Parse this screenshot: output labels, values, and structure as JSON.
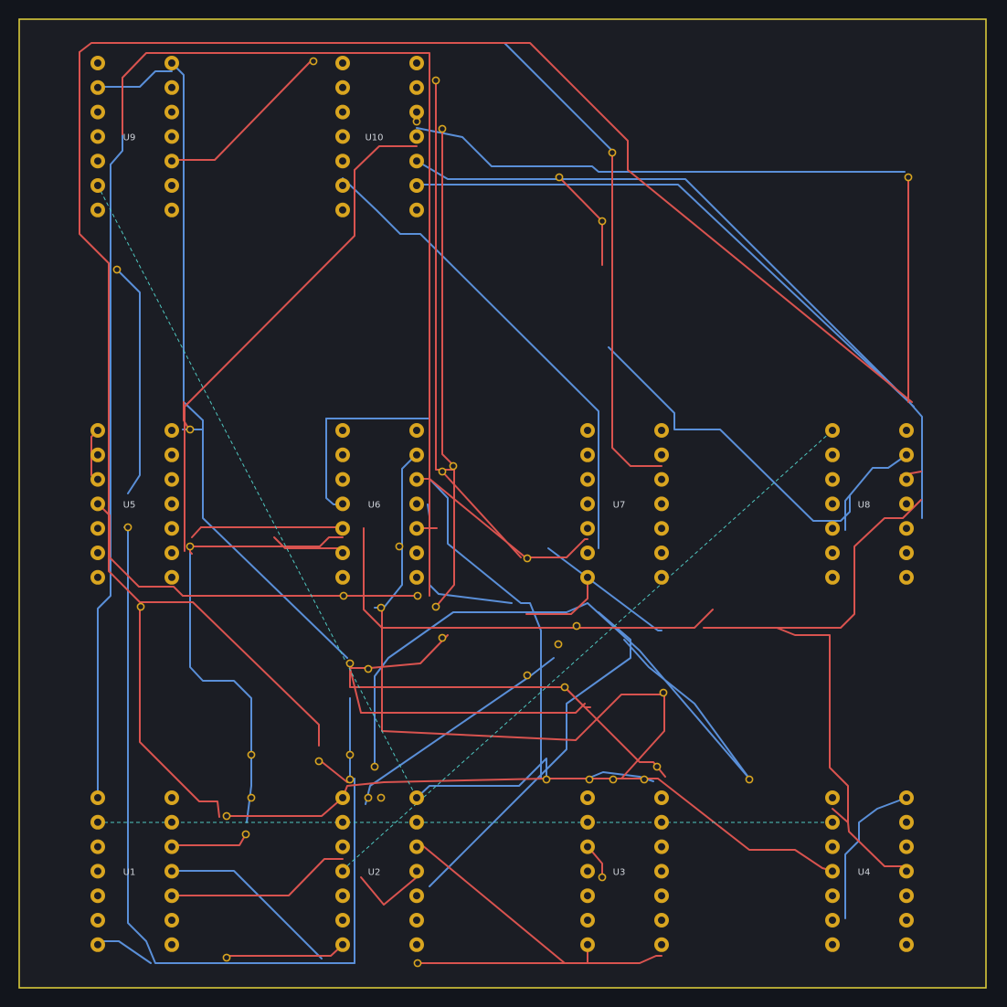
{
  "board": {
    "colors": {
      "background": "#12151c",
      "board_fill": "#1b1d24",
      "edge_cuts": "#d8c93a",
      "front_copper": "#d9534f",
      "back_copper": "#5a8fd8",
      "pad": "#d9a520",
      "pad_hole": "#1b1d24",
      "ratsnest": "#4fc7c0",
      "silkscreen": "#cfd3da"
    },
    "components": [
      {
        "ref": "U9",
        "pins": 14
      },
      {
        "ref": "U10",
        "pins": 14
      },
      {
        "ref": "U5",
        "pins": 14
      },
      {
        "ref": "U6",
        "pins": 14
      },
      {
        "ref": "U7",
        "pins": 14
      },
      {
        "ref": "U8",
        "pins": 14
      },
      {
        "ref": "U1",
        "pins": 14
      },
      {
        "ref": "U2",
        "pins": 14
      },
      {
        "ref": "U3",
        "pins": 14
      },
      {
        "ref": "U4",
        "pins": 14
      }
    ]
  }
}
